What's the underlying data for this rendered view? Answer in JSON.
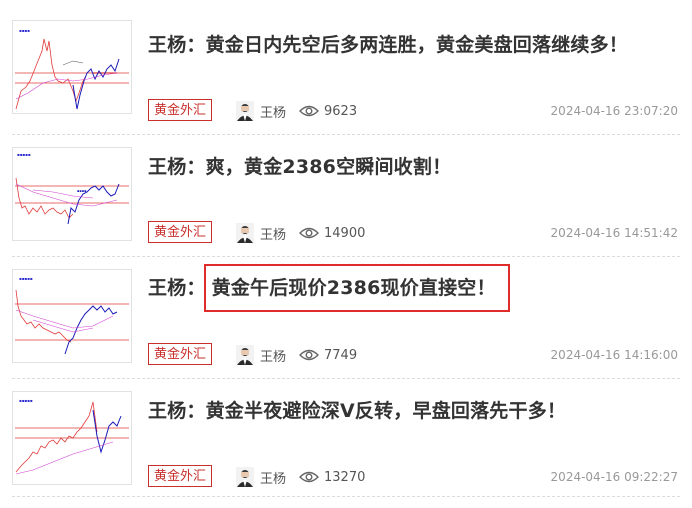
{
  "articles": [
    {
      "title": "王杨：黄金日内先空后多两连胜，黄金美盘回落继续多！",
      "title_prefix": "",
      "title_highlight": "",
      "tag": "黄金外汇",
      "author": "王杨",
      "views": "9623",
      "time": "2024-04-16 23:07:20"
    },
    {
      "title": "王杨：爽，黄金2386空瞬间收割！",
      "title_prefix": "",
      "title_highlight": "",
      "tag": "黄金外汇",
      "author": "王杨",
      "views": "14900",
      "time": "2024-04-16 14:51:42"
    },
    {
      "title": "",
      "title_prefix": "王杨：",
      "title_highlight": "黄金午后现价2386现价直接空！",
      "tag": "黄金外汇",
      "author": "王杨",
      "views": "7749",
      "time": "2024-04-16 14:16:00"
    },
    {
      "title": "王杨：黄金半夜避险深V反转，早盘回落先干多！",
      "title_prefix": "",
      "title_highlight": "",
      "tag": "黄金外汇",
      "author": "王杨",
      "views": "13270",
      "time": "2024-04-16 09:22:27"
    }
  ],
  "colors": {
    "tag": "#c9302c",
    "highlight_border": "#e02b2b",
    "chart_line": "#1a1ab8",
    "chart_red": "#e23a3a"
  },
  "icons": {
    "views": "eye-icon",
    "avatar": "avatar"
  }
}
